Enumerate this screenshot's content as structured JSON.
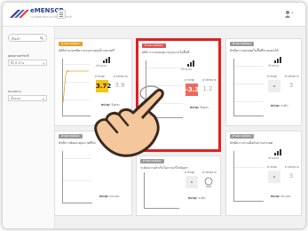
{
  "app": {
    "brand": "eMENSCR",
    "brand_sub": "ระบบติดตามและประเมินผลแห่งชาติ"
  },
  "sidebar": {
    "search_placeholder": "ค้นหา",
    "filters": [
      {
        "label": "ยุทธศาสตร์ชาติ",
        "value": "ทั้ง 6 ด้าน"
      },
      {
        "label": "หน่วยงาน",
        "value": "ทั้งหมด"
      }
    ]
  },
  "cards": [
    {
      "tag": "ด้านความมั่นคง",
      "tag_color": "#e6a028",
      "title": "สถิติจำนวนคดีความรุนแรงต่อเด็กและสตรี",
      "goal": "เป้าหมาย",
      "current_label": "ค่าล่าสุด",
      "current_value": "3.72",
      "current_color": "#f5c518",
      "target_label": "ค่าเป้าหมาย",
      "target_value": "3.8",
      "foot_label": "หน่วย:",
      "foot_value": "ร้อยละ",
      "highlight": false
    },
    {
      "tag": "ด้านความมั่นคง",
      "tag_color": "#e05050",
      "title": "สถิติ การก่อเหตุความรุนแรงในพื้นที่",
      "goal": "เป้าหมาย",
      "current_label": "ค่าล่าสุด",
      "current_value": "-3.3",
      "current_color": "#ee6a5a",
      "target_label": "ค่าเป้าหมาย",
      "target_value": "1.2",
      "foot_label": "หน่วย:",
      "foot_value": "ร้อยละ",
      "highlight": true
    },
    {
      "tag": "ด้านความมั่นคง",
      "tag_color": "#9a9a9a",
      "title": "ดัชนีความสงบสุขในพื้นที่ชายแดนใต้",
      "goal": "เป้าหมาย",
      "current_label": "ค่าล่าสุด",
      "current_value": "-",
      "current_color": "#eeeeee",
      "target_label": "ค่าเป้าหมาย",
      "target_value": "3",
      "foot_label": "หน่วย:",
      "foot_value": "ระดับ",
      "highlight": false
    },
    {
      "tag": "ด้านความมั่นคง",
      "tag_color": "#9a9a9a",
      "title": "ดัชนีการพัฒนาคุณภาพชีวิต",
      "foot_label": "หน่วย:",
      "foot_value": "คะแนน",
      "highlight": false
    },
    {
      "tag": "ด้านความมั่นคง",
      "tag_color": "#9a9a9a",
      "title": "ระดับความสำเร็จในการแก้ไขปัญหา",
      "goal": "เป้าหมาย",
      "current_label": "ค่าล่าสุด",
      "current_value": "-",
      "current_color": "#eeeeee",
      "target_label": "ค่าเป้าหมาย",
      "target_value": "",
      "foot_label": "หน่วย:",
      "foot_value": "ระดับ",
      "highlight": false
    },
    {
      "tag": "ด้านความมั่นคง",
      "tag_color": "#9a9a9a",
      "title": "ดัชนีความร่วมมือกับต่างประเทศ",
      "goal": "เป้าหมาย",
      "current_label": "ค่าล่าสุด",
      "current_value": "-",
      "current_color": "#eeeeee",
      "target_label": "ค่าเป้าหมาย",
      "target_value": "3",
      "foot_label": "หน่วย:",
      "foot_value": "คะแนน",
      "highlight": false
    }
  ],
  "colors": {
    "highlight": "#e02020",
    "brand": "#2a3e8f"
  },
  "icons": {
    "hand": "pointing-hand-icon",
    "user": "user-menu-icon",
    "search": "search-icon"
  }
}
